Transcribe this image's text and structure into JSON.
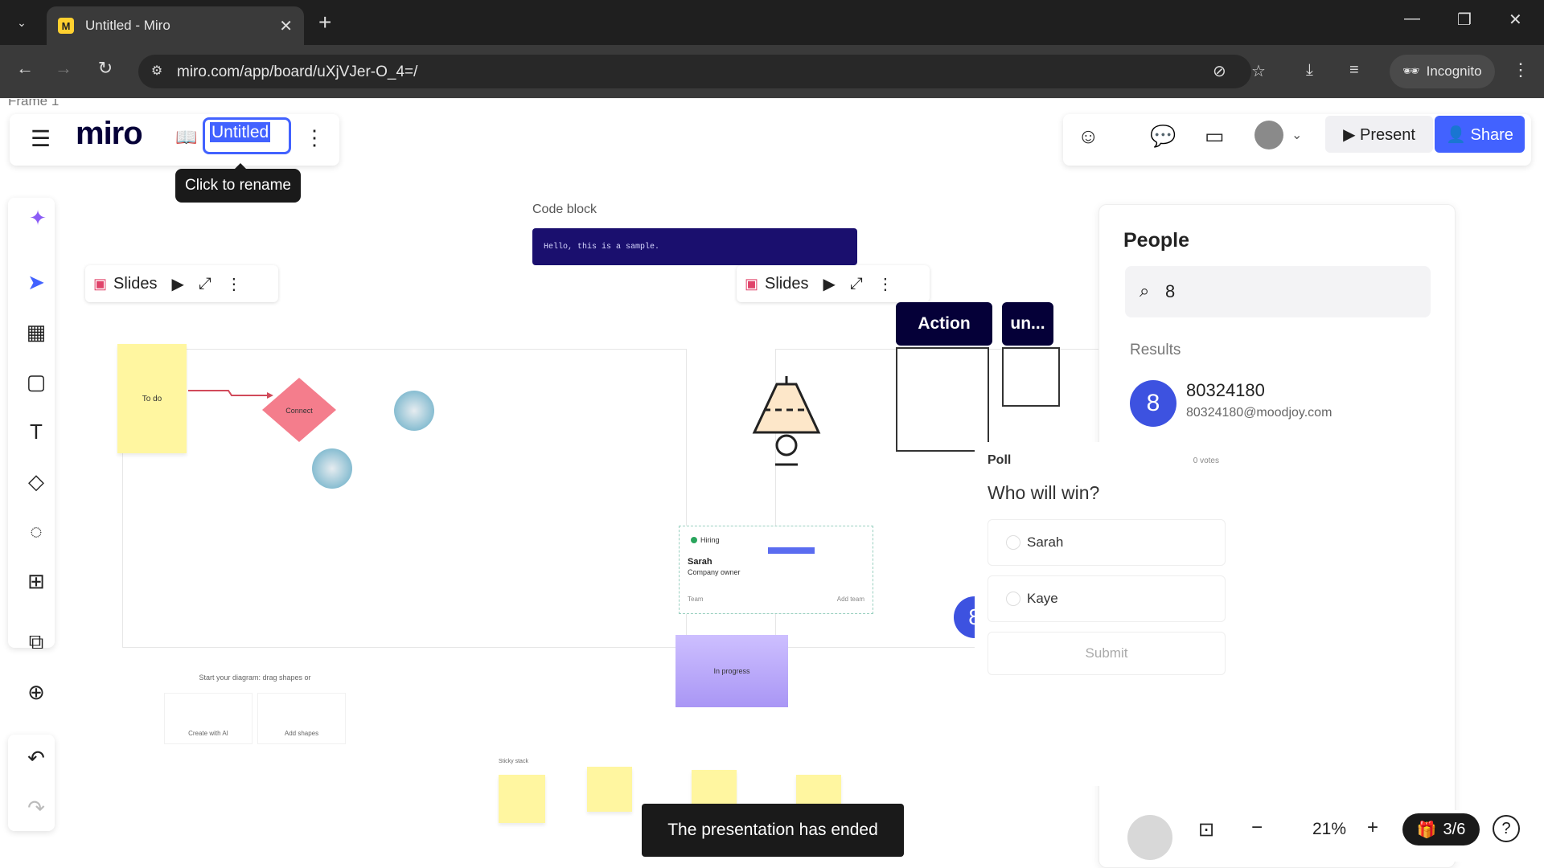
{
  "browser": {
    "tab_title": "Untitled - Miro",
    "url": "miro.com/app/board/uXjVJer-O_4=/",
    "incognito_label": "Incognito"
  },
  "board": {
    "frame_label": "Frame 1",
    "logo": "miro",
    "title_value": "Untitled",
    "tooltip": "Click to rename",
    "present_label": "Present",
    "share_label": "Share",
    "slides_label": "Slides",
    "code_block_label": "Code block",
    "code_text": "Hello, this is a sample.",
    "action_label": "Action",
    "un_label": "un...",
    "sticky_todo": "To do",
    "diamond_label": "Connect",
    "hiring_status": "Hiring",
    "hiring_name": "Sarah",
    "hiring_role": "Company owner",
    "hiring_team": "Team",
    "hiring_add": "Add team",
    "in_progress": "In progress",
    "diagram_hint": "Start your diagram: drag shapes or",
    "create_ai": "Create with AI",
    "add_shapes": "Add shapes",
    "sticky_stack": "Sticky stack",
    "avatar_badge": "8",
    "zoom": "21%",
    "pages": "3/6",
    "toast": "The presentation has ended"
  },
  "people": {
    "title": "People",
    "search_value": "8",
    "results_label": "Results",
    "result": {
      "initial": "8",
      "name": "80324180",
      "email": "80324180@moodjoy.com"
    }
  },
  "poll": {
    "title": "Poll",
    "votes": "0 votes",
    "question": "Who will win?",
    "options": [
      "Sarah",
      "Kaye"
    ],
    "submit": "Submit"
  }
}
